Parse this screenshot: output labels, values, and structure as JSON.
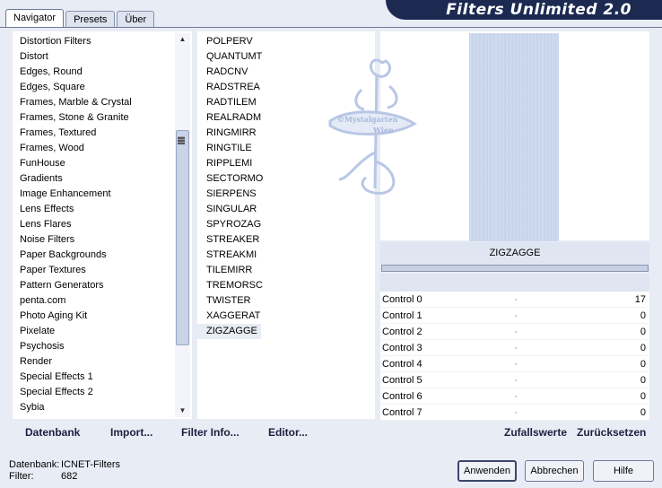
{
  "tabs": [
    {
      "label": "Navigator",
      "active": true
    },
    {
      "label": "Presets",
      "active": false
    },
    {
      "label": "Über",
      "active": false
    }
  ],
  "app_title": "Filters Unlimited 2.0",
  "categories": [
    "Distortion Filters",
    "Distort",
    "Edges, Round",
    "Edges, Square",
    "Frames, Marble & Crystal",
    "Frames, Stone & Granite",
    "Frames, Textured",
    "Frames, Wood",
    "FunHouse",
    "Gradients",
    "Image Enhancement",
    "Lens Effects",
    "Lens Flares",
    "Noise Filters",
    "Paper Backgrounds",
    "Paper Textures",
    "Pattern Generators",
    "penta.com",
    "Photo Aging Kit",
    "Pixelate",
    "Psychosis",
    "Render",
    "Special Effects 1",
    "Special Effects 2",
    "Sybia"
  ],
  "filters": [
    "POLPERV",
    "QUANTUMT",
    "RADCNV",
    "RADSTREA",
    "RADTILEM",
    "REALRADM",
    "RINGMIRR",
    "RINGTILE",
    "RIPPLEMI",
    "SECTORMO",
    "SIERPENS",
    "SINGULAR",
    "SPYROZAG",
    "STREAKER",
    "STREAKMI",
    "TILEMIRR",
    "TREMORSC",
    "TWISTER",
    "XAGGERAT",
    "ZIGZAGGE"
  ],
  "selected_filter": "ZIGZAGGE",
  "links": {
    "database": "Datenbank",
    "import": "Import...",
    "filter_info": "Filter Info...",
    "editor": "Editor...",
    "random": "Zufallswerte",
    "reset": "Zurücksetzen"
  },
  "preview_filter_name": "ZIGZAGGE",
  "controls": [
    {
      "label": "Control 0",
      "value": "17"
    },
    {
      "label": "Control 1",
      "value": "0"
    },
    {
      "label": "Control 2",
      "value": "0"
    },
    {
      "label": "Control 3",
      "value": "0"
    },
    {
      "label": "Control 4",
      "value": "0"
    },
    {
      "label": "Control 5",
      "value": "0"
    },
    {
      "label": "Control 6",
      "value": "0"
    },
    {
      "label": "Control 7",
      "value": "0"
    }
  ],
  "status": {
    "db_key": "Datenbank:",
    "db_value": "ICNET-Filters",
    "filter_key": "Filter:",
    "filter_value": "682"
  },
  "buttons": {
    "apply": "Anwenden",
    "cancel": "Abbrechen",
    "help": "Hilfe"
  },
  "watermark": {
    "line1": "©Mystalgarten",
    "line2": "Wien"
  },
  "colors": {
    "background": "#e8ecf5",
    "banner": "#1c2a52",
    "preview": "#c5d2ea"
  }
}
